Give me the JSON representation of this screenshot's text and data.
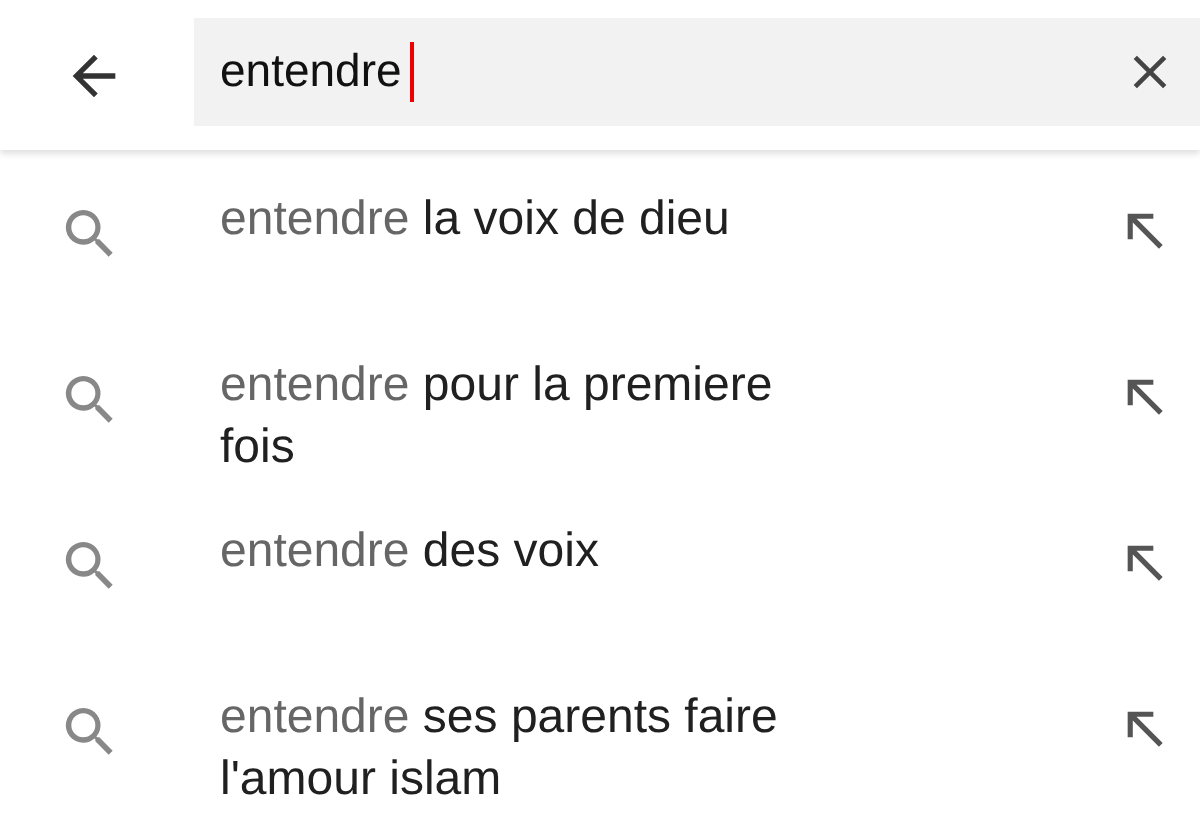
{
  "search": {
    "value": "entendre"
  },
  "suggestions": [
    {
      "match": "entendre",
      "rest": "la voix de dieu"
    },
    {
      "match": "entendre",
      "rest": "pour la premiere fois"
    },
    {
      "match": "entendre",
      "rest": "des voix"
    },
    {
      "match": "entendre",
      "rest": "ses parents faire l'amour islam"
    }
  ]
}
